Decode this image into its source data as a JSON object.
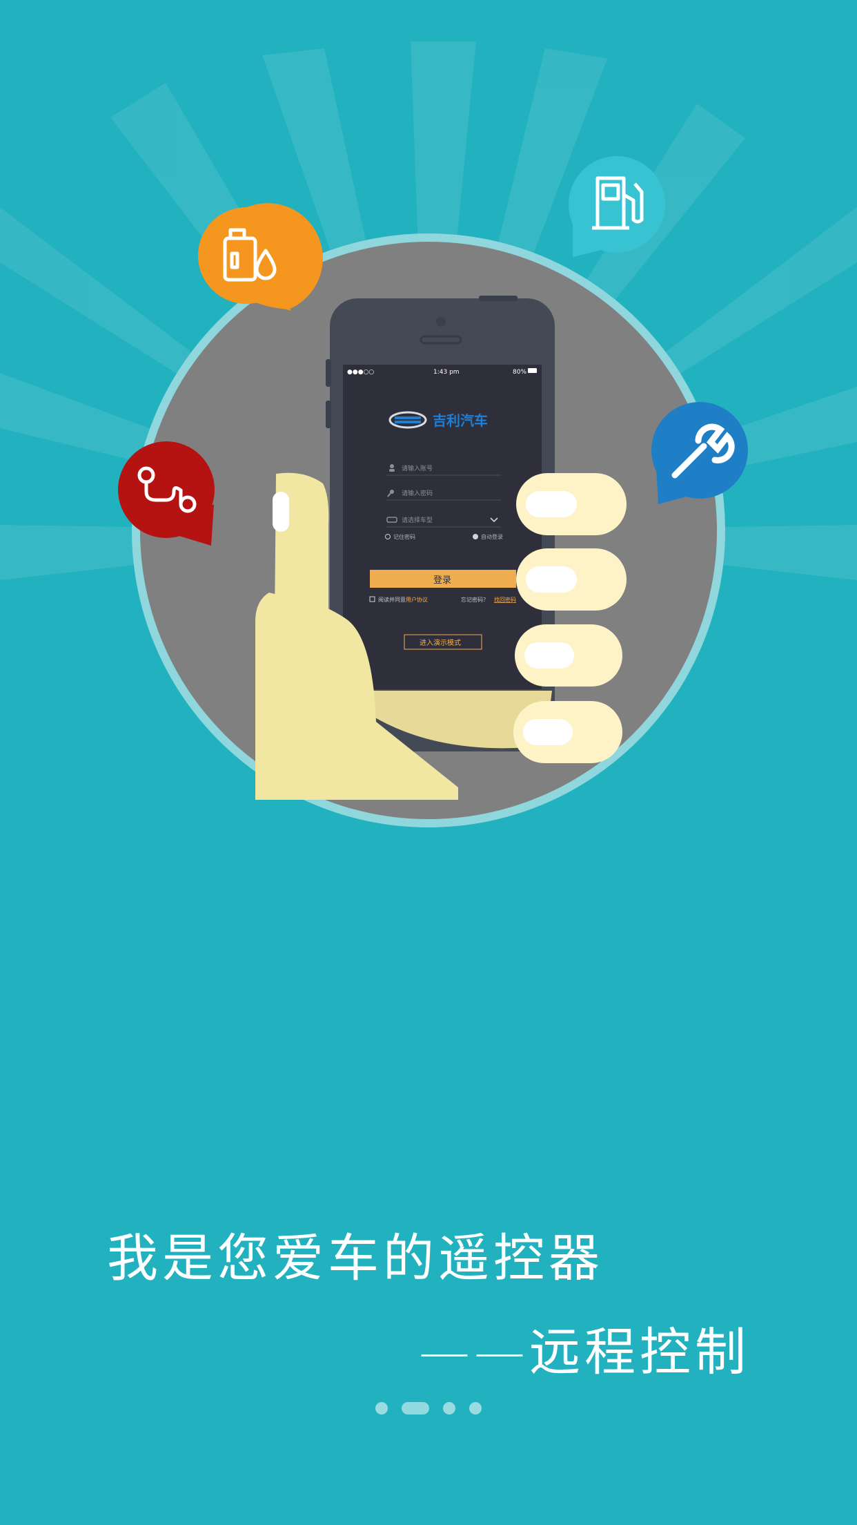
{
  "slide": {
    "headline": "我是您爱车的遥控器",
    "subline": "——远程控制",
    "page_indicator": {
      "total": 4,
      "active_index": 1
    }
  },
  "phone_screen": {
    "status_time": "1:43 pm",
    "status_battery": "80%",
    "brand_name": "吉利汽车",
    "account_placeholder": "请输入账号",
    "password_placeholder": "请输入密码",
    "car_model_placeholder": "请选择车型",
    "remember_password": "记住密码",
    "auto_login": "自动登录",
    "login_button": "登录",
    "agree_prefix": "阅读并同意",
    "agreement_link": "用户协议",
    "forgot_prefix": "忘记密码？",
    "retrieve_password": "找回密码",
    "demo_mode_button": "进入演示模式"
  },
  "colors": {
    "background": "#22b1bf",
    "circle": "#808080",
    "circle_ring": "#8fd6dd",
    "phone_body": "#434a56",
    "phone_screen": "#2f2f3b",
    "brand_blue": "#1e7fd6",
    "login_orange": "#f0ad50",
    "hand": "#f2e6a3",
    "finger_nail": "#fdf3c7",
    "oil_pin": "#f5961f",
    "fuel_pin": "#37c3d2",
    "route_pin": "#b51212",
    "wrench_pin": "#1e7fc6"
  },
  "icons": [
    "oil-bottle-icon",
    "fuel-pump-icon",
    "route-icon",
    "wrench-icon"
  ]
}
